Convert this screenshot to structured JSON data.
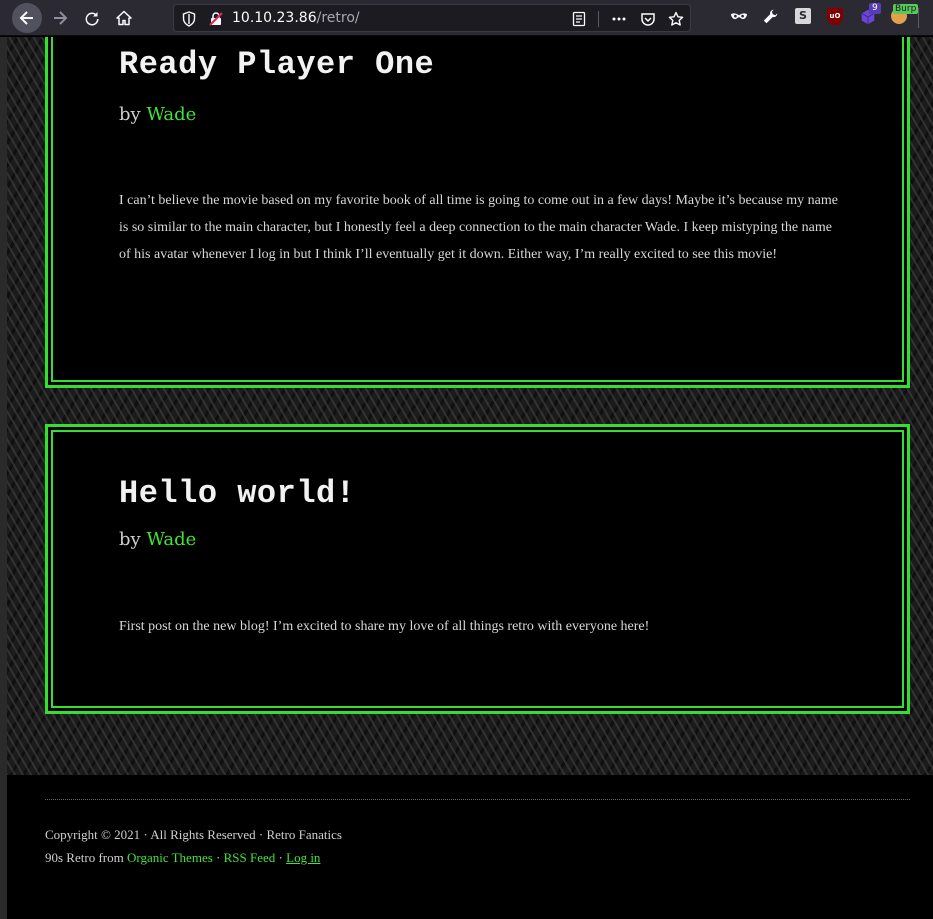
{
  "browser": {
    "url_host": "10.10.23.86",
    "url_path": "/retro/",
    "extension_badge_count": "9",
    "burp_label": "Burp"
  },
  "posts": [
    {
      "title": "Ready Player One",
      "by_prefix": "by",
      "author": "Wade",
      "body": "I can’t believe the movie based on my favorite book of all time is going to come out in a few days! Maybe it’s because my name is so similar to the main character, but I honestly feel a deep connection to the main character Wade. I keep mistyping the name of his avatar whenever I log in but I think I’ll eventually get it down. Either way, I’m really excited to see this movie!"
    },
    {
      "title": "Hello world!",
      "by_prefix": "by",
      "author": "Wade",
      "body": "First post on the new blog! I’m excited to share my love of all things retro with everyone here!"
    }
  ],
  "footer": {
    "copyright": "Copyright © 2021 · All Rights Reserved · Retro Fanatics",
    "credit_prefix": "90s Retro from",
    "theme_link": "Organic Themes",
    "separator": "·",
    "rss_link": "RSS Feed",
    "login_link": "Log in"
  },
  "colors": {
    "accent_green": "#33e02f",
    "background": "#000000",
    "chrome": "#2b2a33"
  }
}
